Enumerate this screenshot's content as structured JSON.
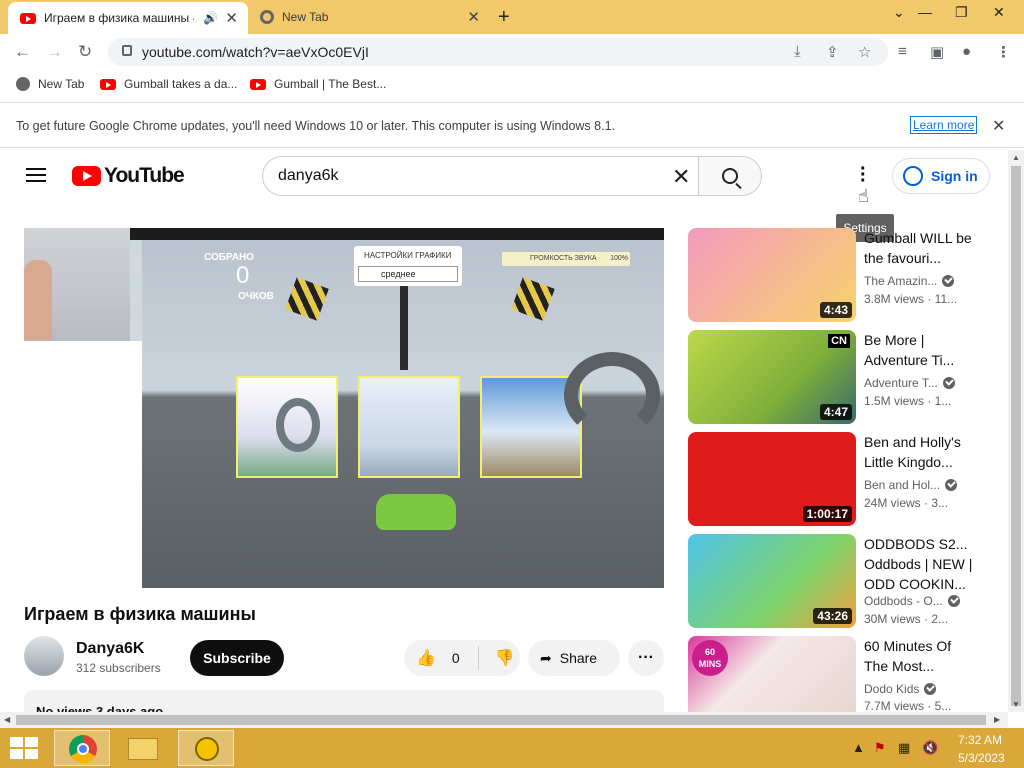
{
  "browser": {
    "tabs": [
      {
        "title": "Играем в физика машины -",
        "active": true
      },
      {
        "title": "New Tab",
        "active": false
      }
    ],
    "url": "youtube.com/watch?v=aeVxOc0EVjI",
    "bookmarks": [
      "New Tab",
      "Gumball takes a da...",
      "Gumball | The Best..."
    ],
    "infobar": {
      "text": "To get future Google Chrome updates, you'll need Windows 10 or later. This computer is using Windows 8.1.",
      "link": "Learn more"
    }
  },
  "youtube": {
    "logo": "YouTube",
    "search_value": "danya6k",
    "tooltip": "Settings",
    "signin": "Sign in"
  },
  "game": {
    "collected": "СОБРАНО",
    "points": "0",
    "points_label": "ОЧКОВ",
    "graphics_label": "НАСТРОЙКИ ГРАФИКИ",
    "graphics_value": "среднее",
    "volume_label": "ГРОМКОСТЬ ЗВУКА",
    "volume_value": "100%"
  },
  "video": {
    "title": "Играем в физика машины",
    "channel": "Danya6K",
    "subscribers": "312 subscribers",
    "subscribe": "Subscribe",
    "likes": "0",
    "share": "Share",
    "description": "No views  3 days ago"
  },
  "related": [
    {
      "title": "Gumball WILL be the favouri...",
      "channel": "The Amazin...",
      "meta": "3.8M views · 11...",
      "duration": "4:43"
    },
    {
      "title": "Be More | Adventure Ti...",
      "channel": "Adventure T...",
      "meta": "1.5M views · 1...",
      "duration": "4:47"
    },
    {
      "title": "Ben and Holly's Little Kingdo...",
      "channel": "Ben and Hol...",
      "meta": "24M views · 3...",
      "duration": "1:00:17"
    },
    {
      "title": "ODDBODS  S2... Oddbods | NEW | ODD COOKIN...",
      "channel": "Oddbods - O...",
      "meta": "30M views · 2...",
      "duration": "43:26"
    },
    {
      "title": "60 Minutes Of The Most...",
      "channel": "Dodo Kids",
      "meta": "7.7M views · 5...",
      "duration": ""
    }
  ],
  "taskbar": {
    "time": "7:32 AM",
    "date": "5/3/2023"
  },
  "colors": {
    "tabstrip": "#f1c96b",
    "taskbar": "#d9a73a",
    "youtube_red": "#ff0000"
  }
}
